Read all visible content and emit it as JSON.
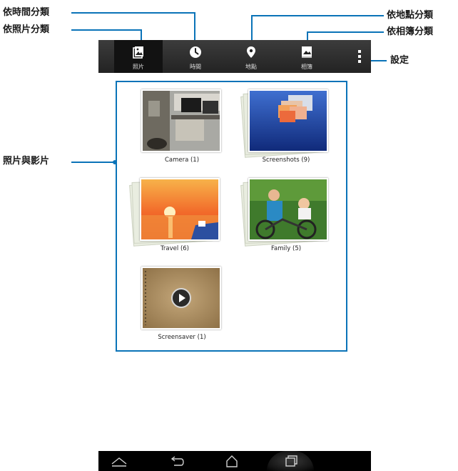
{
  "callouts": {
    "by_time": "依時間分類",
    "by_photo": "依照片分類",
    "by_location": "依地點分類",
    "by_album": "依相簿分類",
    "settings": "設定",
    "photos_videos": "照片與影片"
  },
  "tabs": [
    {
      "label": "照片",
      "icon": "photo-icon"
    },
    {
      "label": "時間",
      "icon": "clock-icon"
    },
    {
      "label": "地點",
      "icon": "location-pin-icon"
    },
    {
      "label": "相簿",
      "icon": "album-icon"
    }
  ],
  "albums": [
    {
      "label": "Camera (1)"
    },
    {
      "label": "Screenshots (9)"
    },
    {
      "label": "Travel (6)"
    },
    {
      "label": "Family (5)"
    },
    {
      "label": "Screensaver (1)"
    }
  ],
  "navbar": {
    "icons": [
      "home-up-icon",
      "back-icon",
      "home-icon",
      "recents-icon"
    ]
  },
  "colors": {
    "callout_line": "#0a73b8",
    "tabbar": "#2e2e2e",
    "navbar": "#000000"
  }
}
